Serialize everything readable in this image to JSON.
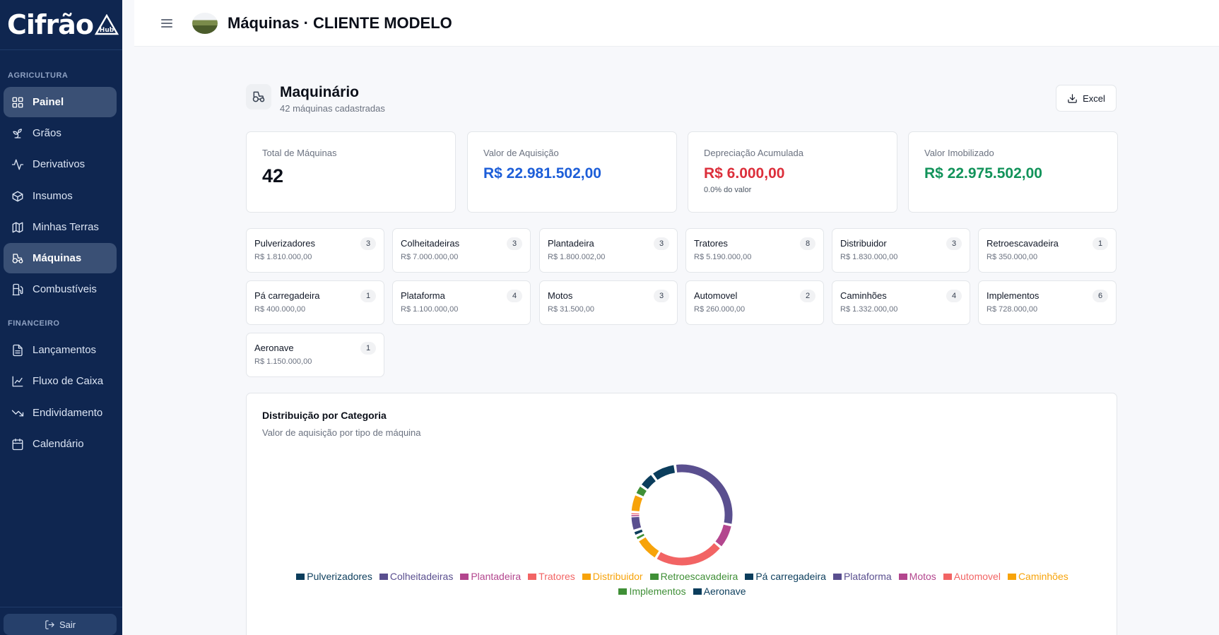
{
  "sidebar": {
    "logo": {
      "text": "Cifrão",
      "badge": "Hub"
    },
    "sections": [
      {
        "label": "AGRICULTURA",
        "items": [
          {
            "label": "Painel",
            "icon": "grid-icon",
            "active": false,
            "highlight": true
          },
          {
            "label": "Grãos",
            "icon": "sprout-icon"
          },
          {
            "label": "Derivativos",
            "icon": "activity-icon"
          },
          {
            "label": "Insumos",
            "icon": "box-icon"
          },
          {
            "label": "Minhas Terras",
            "icon": "map-icon"
          },
          {
            "label": "Máquinas",
            "icon": "tractor-icon",
            "active": true
          },
          {
            "label": "Combustíveis",
            "icon": "fuel-icon"
          }
        ]
      },
      {
        "label": "FINANCEIRO",
        "items": [
          {
            "label": "Lançamentos",
            "icon": "file-text-icon"
          },
          {
            "label": "Fluxo de Caixa",
            "icon": "line-chart-icon"
          },
          {
            "label": "Endividamento",
            "icon": "trending-down-icon"
          },
          {
            "label": "Calendário",
            "icon": "calendar-icon"
          }
        ]
      }
    ],
    "logout_label": "Sair"
  },
  "header": {
    "title": "Máquinas · CLIENTE MODELO"
  },
  "machinery": {
    "title": "Maquinário",
    "subtitle": "42 máquinas cadastradas",
    "excel_label": "Excel"
  },
  "stats": [
    {
      "label": "Total de Máquinas",
      "value": "42",
      "color": "#0b0f19"
    },
    {
      "label": "Valor de Aquisição",
      "value": "R$ 22.981.502,00",
      "color": "#1d5ed8"
    },
    {
      "label": "Depreciação Acumulada",
      "value": "R$ 6.000,00",
      "color": "#dc2f3b",
      "note": "0.0% do valor"
    },
    {
      "label": "Valor Imobilizado",
      "value": "R$ 22.975.502,00",
      "color": "#12935a"
    }
  ],
  "categories": [
    {
      "name": "Pulverizadores",
      "value": "R$ 1.810.000,00",
      "count": "3"
    },
    {
      "name": "Colheitadeiras",
      "value": "R$ 7.000.000,00",
      "count": "3"
    },
    {
      "name": "Plantadeira",
      "value": "R$ 1.800.002,00",
      "count": "3"
    },
    {
      "name": "Tratores",
      "value": "R$ 5.190.000,00",
      "count": "8"
    },
    {
      "name": "Distribuidor",
      "value": "R$ 1.830.000,00",
      "count": "3"
    },
    {
      "name": "Retroescavadeira",
      "value": "R$ 350.000,00",
      "count": "1"
    },
    {
      "name": "Pá carregadeira",
      "value": "R$ 400.000,00",
      "count": "1"
    },
    {
      "name": "Plataforma",
      "value": "R$ 1.100.000,00",
      "count": "4"
    },
    {
      "name": "Motos",
      "value": "R$ 31.500,00",
      "count": "3"
    },
    {
      "name": "Automovel",
      "value": "R$ 260.000,00",
      "count": "2"
    },
    {
      "name": "Caminhões",
      "value": "R$ 1.332.000,00",
      "count": "4"
    },
    {
      "name": "Implementos",
      "value": "R$ 728.000,00",
      "count": "6"
    },
    {
      "name": "Aeronave",
      "value": "R$ 1.150.000,00",
      "count": "1"
    }
  ],
  "chart_data": {
    "type": "pie",
    "title": "Distribuição por Categoria",
    "subtitle": "Valor de aquisição por tipo de máquina",
    "categories": [
      "Pulverizadores",
      "Colheitadeiras",
      "Plantadeira",
      "Tratores",
      "Distribuidor",
      "Retroescavadeira",
      "Pá carregadeira",
      "Plataforma",
      "Motos",
      "Automovel",
      "Caminhões",
      "Implementos",
      "Aeronave"
    ],
    "values": [
      1810000,
      7000000,
      1800002,
      5190000,
      1830000,
      350000,
      400000,
      1100000,
      31500,
      260000,
      1332000,
      728000,
      1150000
    ],
    "colors": [
      "#0b3d5c",
      "#5a4f8f",
      "#b3468e",
      "#f26464",
      "#f7a30a",
      "#3f8f36",
      "#0b3d5c",
      "#5a4f8f",
      "#b3468e",
      "#f26464",
      "#f7a30a",
      "#3f8f36",
      "#0b3d5c"
    ],
    "start_category": "Colheitadeiras",
    "legend_position": "bottom",
    "donut": true
  }
}
